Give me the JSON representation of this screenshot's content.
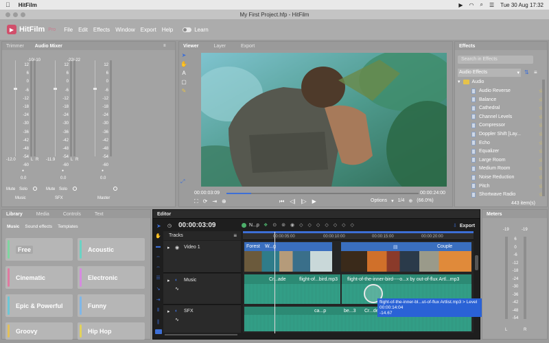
{
  "mac_menubar": {
    "app": "HitFilm",
    "datetime": "Tue 30 Aug 17:32"
  },
  "window": {
    "title": "My First Project.hfp - HitFilm"
  },
  "app": {
    "logo": {
      "name": "HitFilm",
      "plan": "Pro"
    },
    "menu": [
      "File",
      "Edit",
      "Effects",
      "Window",
      "Export",
      "Help"
    ],
    "learn_label": "Learn"
  },
  "left_top_panel": {
    "tabs": [
      "Trimmer",
      "Audio Mixer"
    ],
    "scale": [
      "12",
      "6",
      "0",
      "-6",
      "-12",
      "-18",
      "-24",
      "-30",
      "-36",
      "-42",
      "-48",
      "-54",
      "-60"
    ],
    "channels": [
      {
        "name": "Music",
        "peak": "-10/-10",
        "level": "-12.0",
        "gain": "0.0"
      },
      {
        "name": "SFX",
        "peak": "-22/-22",
        "level": "-11.9",
        "gain": "0.0"
      },
      {
        "name": "Master",
        "peak": "",
        "level": "",
        "gain": "0.0"
      }
    ],
    "mute": "Mute",
    "solo": "Solo",
    "l": "L",
    "r": "R"
  },
  "viewer": {
    "tabs": [
      "Viewer",
      "Layer",
      "Export"
    ],
    "time_current": "00:00:03:09",
    "time_total": "00:00:24:00",
    "options_label": "Options",
    "fraction": "1/4",
    "zoom": "(66.0%)"
  },
  "effects": {
    "tab": "Effects",
    "search_placeholder": "Search in Effects",
    "category": "Audio Effects",
    "folder": "Audio",
    "items": [
      "Audio Reverse",
      "Balance",
      "Cathedral",
      "Channel Levels",
      "Compressor",
      "Doppler Shift [Lay...",
      "Echo",
      "Equalizer",
      "Large Room",
      "Medium Room",
      "Noise Reduction",
      "Pitch",
      "Shortwave Radio"
    ],
    "count": "443 item(s)"
  },
  "library": {
    "tabs": [
      "Library",
      "Media",
      "Controls",
      "Text"
    ],
    "subtabs": [
      "Music",
      "Sound effects",
      "Templates"
    ],
    "tiles": [
      {
        "label": "Free",
        "color": "#7fd6a0"
      },
      {
        "label": "Acoustic",
        "color": "#6bd3c4"
      },
      {
        "label": "Cinematic",
        "color": "#e07aa0"
      },
      {
        "label": "Electronic",
        "color": "#d68ae0"
      },
      {
        "label": "Epic & Powerful",
        "color": "#6cc7d6"
      },
      {
        "label": "Funny",
        "color": "#7fb7e8"
      },
      {
        "label": "Groovy",
        "color": "#e3c05a"
      },
      {
        "label": "Hip Hop",
        "color": "#e3d35a"
      }
    ]
  },
  "editor": {
    "tab": "Editor",
    "timecode": "00:00:03:09",
    "new_label": "N...p",
    "export_label": "Export",
    "tracks_label": "Tracks",
    "ruler": [
      "00:00:05:00",
      "00:00:10:00",
      "00:00:15:00",
      "00:00:20:00"
    ],
    "tracks": [
      {
        "name": "Video 1"
      },
      {
        "name": "Music"
      },
      {
        "name": "SFX"
      }
    ],
    "video_clips": [
      "Forest",
      "W...g",
      "Couple"
    ],
    "music_clips": [
      "Cr...ade",
      "flight-of...bird.mp3",
      "flight-of-the-inner-bird----o...x by out-of-flux Artl...mp3"
    ],
    "sfx_clips": [
      "ca...p",
      "be...3",
      "Cr...de"
    ],
    "tooltip": [
      "flight-of-the-inner-bl...ut-of-flux Artlist.mp3 > Level",
      "00:00:14:04",
      "-14.67"
    ]
  },
  "meters": {
    "tab": "Meters",
    "peaks": [
      "-19",
      "-19"
    ],
    "scale": [
      "6",
      "0",
      "-6",
      "-12",
      "-18",
      "-24",
      "-30",
      "-36",
      "-42",
      "-48",
      "-54"
    ],
    "l": "L",
    "r": "R"
  }
}
